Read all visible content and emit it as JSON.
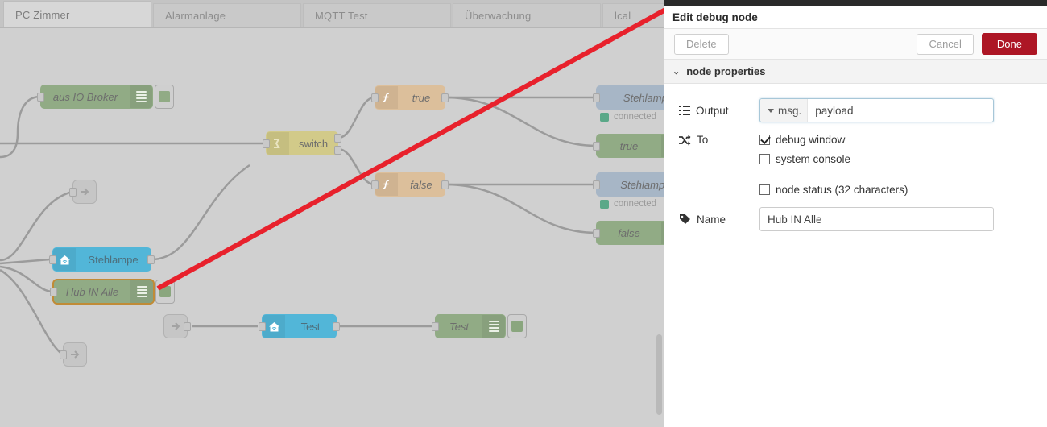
{
  "editor": {
    "tabs": [
      {
        "label": "PC Zimmer",
        "active": true
      },
      {
        "label": "Alarmanlage",
        "active": false
      },
      {
        "label": "MQTT Test",
        "active": false
      },
      {
        "label": "Überwachung",
        "active": false
      },
      {
        "label": "lcal",
        "active": false
      }
    ],
    "nodes": {
      "aus_io_broker": "aus IO Broker",
      "switch": "switch",
      "func_true": "true",
      "func_false": "false",
      "debug_true": "true",
      "debug_false": "false",
      "mqtt_top": "Stehlampe",
      "mqtt_bottom": "Stehlampe_",
      "mqtt_status": "connected",
      "stehlampe": "Stehlampe",
      "hub_in_alle": "Hub IN Alle",
      "test_blue": "Test",
      "test_debug": "Test"
    },
    "annotation_color": "#e8212c"
  },
  "panel": {
    "title": "Edit debug node",
    "delete_label": "Delete",
    "cancel_label": "Cancel",
    "done_label": "Done",
    "section_label": "node properties",
    "chevron": "⌄",
    "accent_color": "#ad1625",
    "fields": {
      "output_label": "Output",
      "output_type": "msg.",
      "output_value": "payload",
      "to_label": "To",
      "to_options": [
        {
          "label": "debug window",
          "checked": true
        },
        {
          "label": "system console",
          "checked": false
        },
        {
          "label": "node status (32 characters)",
          "checked": false
        }
      ],
      "name_label": "Name",
      "name_value": "Hub IN Alle"
    }
  }
}
